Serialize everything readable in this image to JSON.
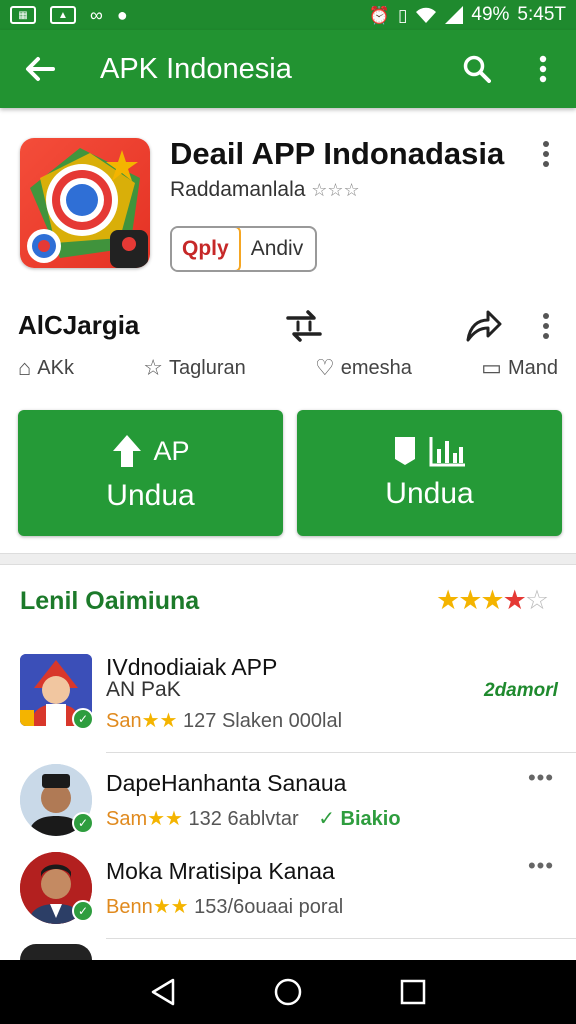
{
  "status_bar": {
    "battery": "49%",
    "time": "5:45T"
  },
  "app_bar": {
    "title": "APK Indonesia"
  },
  "app": {
    "name": "Deail APP Indonadasia",
    "developer": "Raddamanlala",
    "developer_stars": "☆☆☆",
    "chip_primary": "Qply",
    "chip_secondary": "Andiv"
  },
  "info": {
    "title": "AlCJargia",
    "stats": [
      {
        "icon": "home-icon",
        "label": "AKk"
      },
      {
        "icon": "star-outline-icon",
        "label": "Tagluran"
      },
      {
        "icon": "heart-icon",
        "label": "emesha"
      },
      {
        "icon": "comment-icon",
        "label": "Mand"
      }
    ]
  },
  "buttons": {
    "left_top": "AP",
    "left_bottom": "Undua",
    "right_bottom": "Undua"
  },
  "section": {
    "title": "Lenil Oaimiuna",
    "rating_stars": "★★★★☆"
  },
  "list": [
    {
      "title": "IVdnodiaiak APP",
      "subtitle": "AN PaK",
      "meta_prefix": "San",
      "meta_stars": "★★",
      "meta_text": "127  Slaken 000lal",
      "right": "2damorl"
    },
    {
      "title": "DapeHanhanta Sanaua",
      "meta_prefix": "Sam",
      "meta_stars": "★★",
      "meta_text": "132 6ablvtar",
      "verified": "Biakio"
    },
    {
      "title": "Moka Mratisipa Kanaa",
      "meta_prefix": "Benn",
      "meta_stars": "★★",
      "meta_text": "153/6ouaai   poral"
    }
  ],
  "colors": {
    "primary": "#229331",
    "status_bar": "#1f8a2e",
    "button": "#259a37",
    "accent_star": "#f4b400"
  }
}
